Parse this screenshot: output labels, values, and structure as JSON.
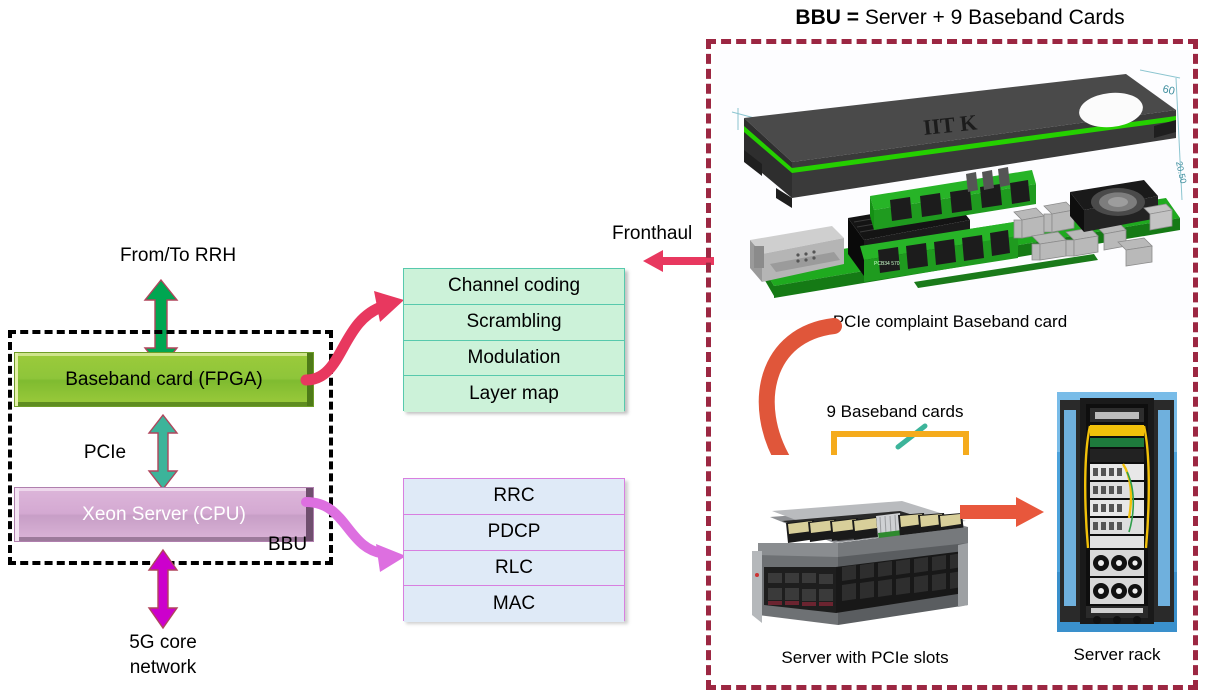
{
  "left_diagram": {
    "top_label": "From/To RRH",
    "fpga_block": "Baseband card (FPGA)",
    "interconnect_label": "PCIe",
    "cpu_block": "Xeon Server (CPU)",
    "bbu_tag": "BBU",
    "bottom_label": "5G core\nnetwork",
    "colors": {
      "fpga_green": "#9ccb3b",
      "cpu_purple": "#d4a9d2",
      "rrh_arrow_green": "#00a651",
      "pcie_arrow_teal": "#3cb49a",
      "core_arrow_magenta": "#cc00cc",
      "dashed_box": "#000000"
    }
  },
  "phy_stack": {
    "rows": [
      "Channel coding",
      "Scrambling",
      "Modulation",
      "Layer map"
    ],
    "fill": "#ccf2d9",
    "border": "#57c9ad",
    "arrow_color": "#e8385f"
  },
  "upper_layer_stack": {
    "rows": [
      "RRC",
      "PDCP",
      "RLC",
      "MAC"
    ],
    "fill": "#dfeaf7",
    "border": "#d87fe0",
    "arrow_color": "#dd6fe0"
  },
  "fronthaul": {
    "label": "Fronthaul",
    "arrow_color": "#e8385f"
  },
  "right_panel": {
    "title_bold": "BBU =",
    "title_rest": " Server + 9 Baseband Cards",
    "border_color": "#9c2742",
    "baseband_card_caption": "PCIe complaint Baseband  card",
    "card_marking": "IIT K",
    "card_dimension_label": "60",
    "nine_cards_label": "9 Baseband cards",
    "server_caption": "Server with PCIe slots",
    "rack_caption": "Server rack",
    "bracket_color": "#f5ab1c",
    "big_arrow_color": "#e0563a",
    "straight_arrow_color": "#e8573c",
    "pointer_color": "#3cb49a"
  }
}
